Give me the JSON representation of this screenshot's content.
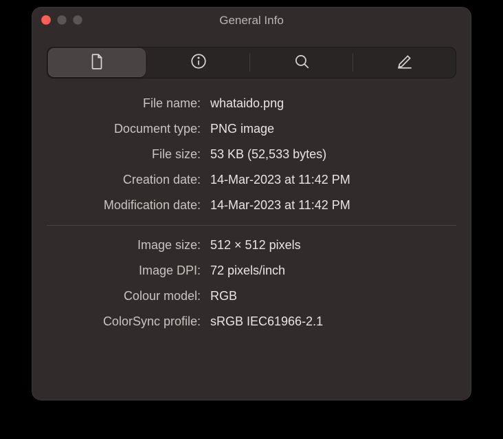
{
  "window": {
    "title": "General Info"
  },
  "tabs": {
    "file": "file-icon",
    "info": "info-icon",
    "search": "search-icon",
    "edit": "pencil-icon"
  },
  "info": {
    "section1": [
      {
        "label": "File name:",
        "value": "whataido.png"
      },
      {
        "label": "Document type:",
        "value": "PNG image"
      },
      {
        "label": "File size:",
        "value": "53 KB (52,533 bytes)"
      },
      {
        "label": "Creation date:",
        "value": "14-Mar-2023 at 11:42 PM"
      },
      {
        "label": "Modification date:",
        "value": "14-Mar-2023 at 11:42 PM"
      }
    ],
    "section2": [
      {
        "label": "Image size:",
        "value": "512 × 512 pixels"
      },
      {
        "label": "Image DPI:",
        "value": "72 pixels/inch"
      },
      {
        "label": "Colour model:",
        "value": "RGB"
      },
      {
        "label": "ColorSync profile:",
        "value": "sRGB IEC61966-2.1"
      }
    ]
  }
}
